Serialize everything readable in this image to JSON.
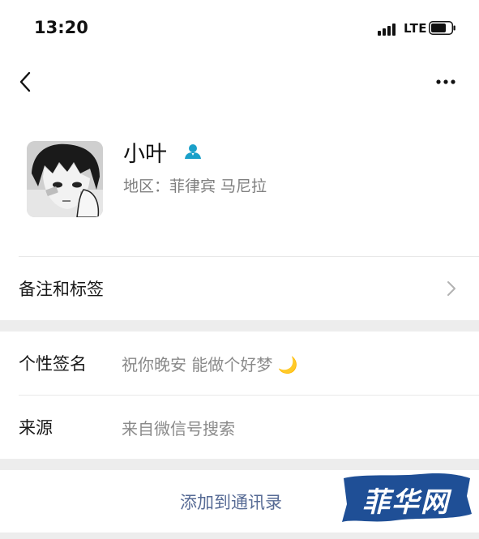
{
  "status_bar": {
    "time": "13:20",
    "network": "LTE"
  },
  "profile": {
    "name": "小叶",
    "region": "地区：菲律宾 马尼拉"
  },
  "remarks_row": {
    "label": "备注和标签"
  },
  "signature_row": {
    "label": "个性签名",
    "value": "祝你晚安 能做个好梦",
    "emoji": "🌙"
  },
  "source_row": {
    "label": "来源",
    "value": "来自微信号搜索"
  },
  "action": {
    "add_contact_label": "添加到通讯录"
  },
  "watermark": {
    "text": "菲华网"
  },
  "colors": {
    "link": "#576b95",
    "verified": "#1aa0c9",
    "section_gap": "#ededed"
  }
}
